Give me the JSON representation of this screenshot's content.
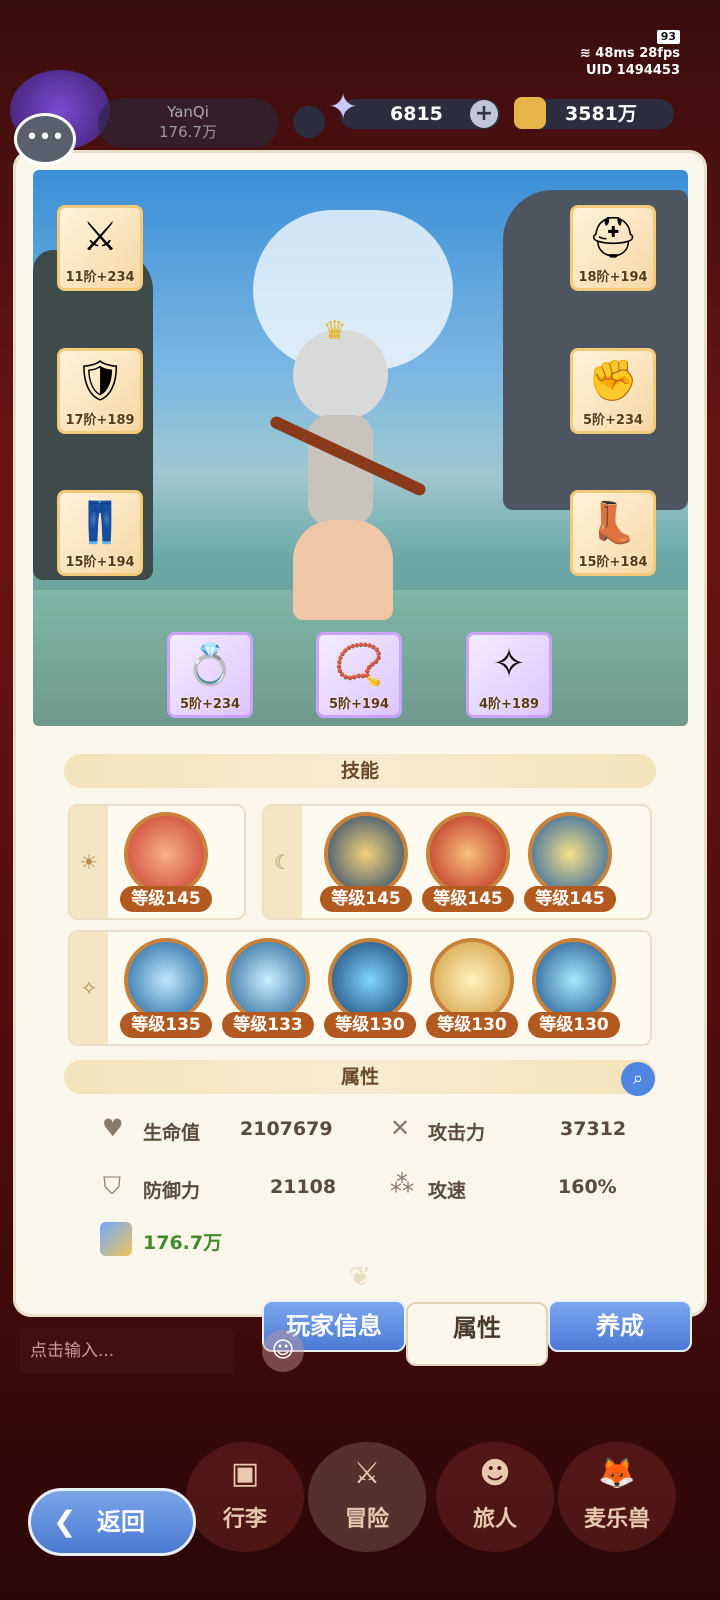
{
  "status": {
    "battery": "93",
    "ping": "48ms",
    "fps": "28fps",
    "uid": "UID 1494453"
  },
  "player": {
    "name": "YanQi",
    "power": "176.7万"
  },
  "currency": {
    "stars": "6815",
    "coins": "3581万"
  },
  "equipment": [
    {
      "slot": "weapon",
      "level": "11阶",
      "bonus": "+234",
      "icon": "sword-icon"
    },
    {
      "slot": "helmet",
      "level": "18阶",
      "bonus": "+194",
      "icon": "helmet-icon"
    },
    {
      "slot": "armor",
      "level": "17阶",
      "bonus": "+189",
      "icon": "armor-icon"
    },
    {
      "slot": "gloves",
      "level": "5阶",
      "bonus": "+234",
      "icon": "gauntlet-icon"
    },
    {
      "slot": "pants",
      "level": "15阶",
      "bonus": "+194",
      "icon": "pants-icon"
    },
    {
      "slot": "boots",
      "level": "15阶",
      "bonus": "+184",
      "icon": "boots-icon"
    },
    {
      "slot": "ring",
      "level": "5阶",
      "bonus": "+234",
      "icon": "ring-icon"
    },
    {
      "slot": "necklace",
      "level": "5阶",
      "bonus": "+194",
      "icon": "necklace-icon"
    },
    {
      "slot": "charm",
      "level": "4阶",
      "bonus": "+189",
      "icon": "charm-icon"
    }
  ],
  "skills_title": "技能",
  "skills": {
    "sun": [
      "等级145"
    ],
    "moon": [
      "等级145",
      "等级145",
      "等级145"
    ],
    "star": [
      "等级135",
      "等级133",
      "等级130",
      "等级130",
      "等级130"
    ]
  },
  "attributes_title": "属性",
  "attributes": {
    "hp_label": "生命值",
    "hp": "2107679",
    "atk_label": "攻击力",
    "atk": "37312",
    "def_label": "防御力",
    "def": "21108",
    "spd_label": "攻速",
    "spd": "160%",
    "power": "176.7万"
  },
  "tabs": {
    "player_info": "玩家信息",
    "attributes": "属性",
    "cultivate": "养成"
  },
  "chat": {
    "placeholder": "点击输入..."
  },
  "nav": {
    "bag": "行李",
    "adventure": "冒险",
    "traveler": "旅人",
    "pet": "麦乐兽"
  },
  "back": "返回"
}
